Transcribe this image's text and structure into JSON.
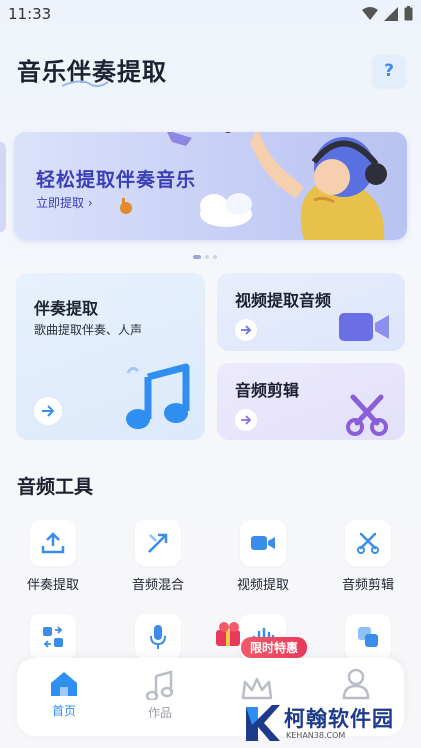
{
  "status_bar": {
    "time": "11:33"
  },
  "header": {
    "title": "音乐伴奏提取",
    "help_label": "?"
  },
  "banner": {
    "title": "轻松提取伴奏音乐",
    "cta": "立即提取"
  },
  "feature_cards": {
    "accompaniment": {
      "title": "伴奏提取",
      "subtitle": "歌曲提取伴奏、人声"
    },
    "video_audio": {
      "title": "视频提取音频"
    },
    "audio_edit": {
      "title": "音频剪辑"
    }
  },
  "tools": {
    "section_title": "音频工具",
    "items": [
      {
        "label": "伴奏提取",
        "icon": "upload-icon"
      },
      {
        "label": "音频混合",
        "icon": "merge-arrows-icon"
      },
      {
        "label": "视频提取",
        "icon": "video-camera-icon"
      },
      {
        "label": "音频剪辑",
        "icon": "scissors-icon"
      },
      {
        "label": "",
        "icon": "convert-icon"
      },
      {
        "label": "",
        "icon": "microphone-icon"
      },
      {
        "label": "",
        "icon": "waveform-icon"
      },
      {
        "label": "",
        "icon": "layers-icon"
      }
    ]
  },
  "tabbar": {
    "tabs": [
      {
        "label": "首页",
        "icon": "home-icon",
        "active": true
      },
      {
        "label": "作品",
        "icon": "music-note-icon",
        "active": false
      },
      {
        "label": "",
        "icon": "crown-icon",
        "active": false
      },
      {
        "label": "",
        "icon": "user-icon",
        "active": false
      }
    ],
    "promo_badge": "限时特惠"
  },
  "watermark": {
    "name": "柯翰软件园",
    "url": "KEHAN38.COM"
  },
  "colors": {
    "accent": "#3a8de8",
    "banner_text": "#3b3fb5",
    "promo": "#e8395a"
  }
}
